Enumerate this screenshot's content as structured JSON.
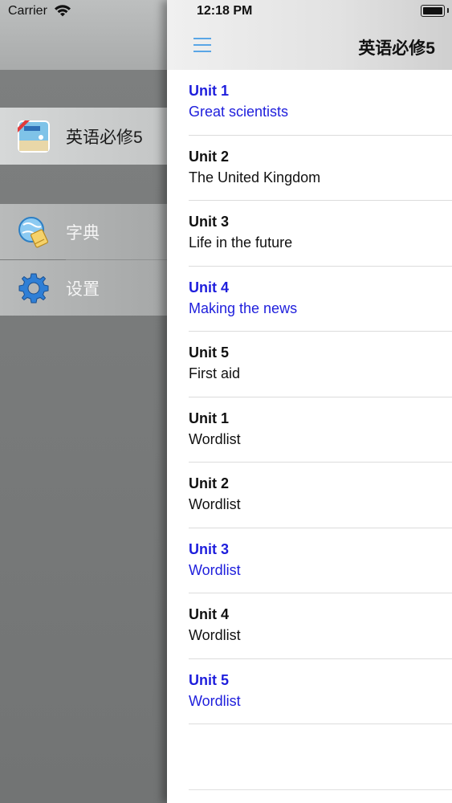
{
  "status_bar": {
    "carrier": "Carrier",
    "time": "12:18 PM"
  },
  "sidebar": {
    "items": [
      {
        "label": "英语必修5",
        "icon": "textbook-icon"
      },
      {
        "label": "字典",
        "icon": "dictionary-globe-icon"
      },
      {
        "label": "设置",
        "icon": "gear-icon"
      }
    ]
  },
  "navbar": {
    "title": "英语必修5",
    "menu_icon": "hamburger-menu-icon"
  },
  "list": {
    "rows": [
      {
        "unit": "Unit 1",
        "title": "Great scientists",
        "highlighted": true
      },
      {
        "unit": "Unit 2",
        "title": "The United Kingdom",
        "highlighted": false
      },
      {
        "unit": "Unit 3",
        "title": "Life in the future",
        "highlighted": false
      },
      {
        "unit": "Unit 4",
        "title": "Making the news",
        "highlighted": true
      },
      {
        "unit": "Unit 5",
        "title": "First aid",
        "highlighted": false
      },
      {
        "unit": "Unit 1",
        "title": "Wordlist",
        "highlighted": false
      },
      {
        "unit": "Unit 2",
        "title": "Wordlist",
        "highlighted": false
      },
      {
        "unit": "Unit 3",
        "title": "Wordlist",
        "highlighted": true
      },
      {
        "unit": "Unit 4",
        "title": "Wordlist",
        "highlighted": false
      },
      {
        "unit": "Unit 5",
        "title": "Wordlist",
        "highlighted": true
      }
    ]
  },
  "colors": {
    "highlight": "#1e1edc",
    "menu_icon": "#5aa6e6"
  }
}
